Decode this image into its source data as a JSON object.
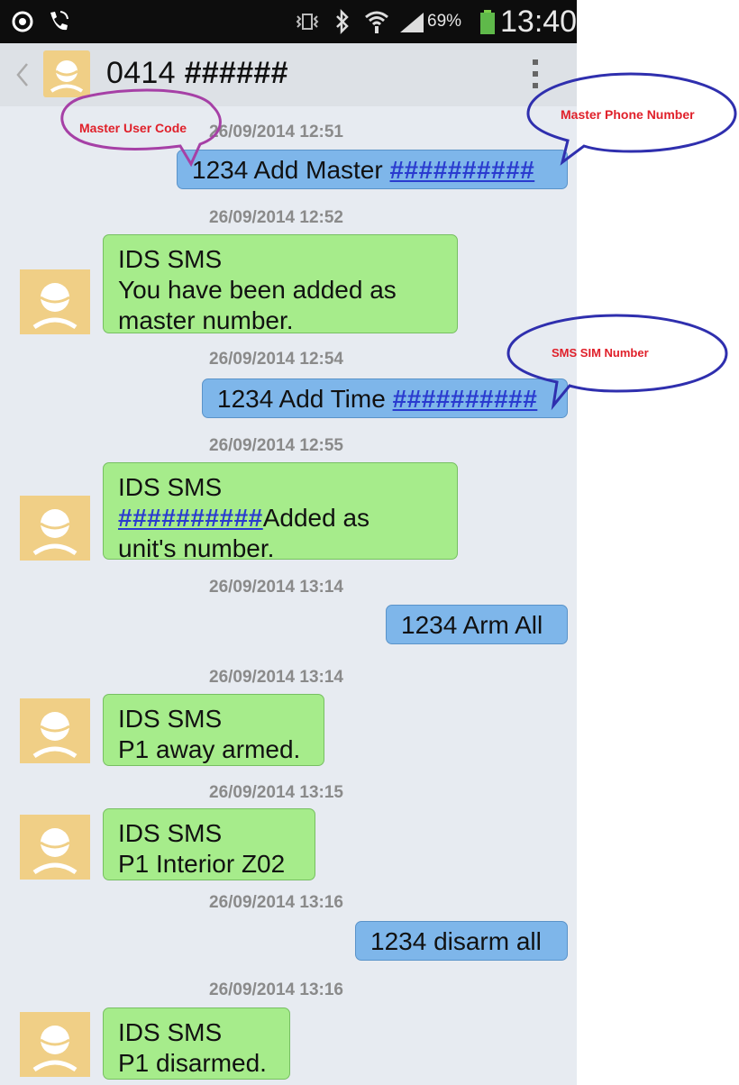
{
  "status_bar": {
    "battery_percent": "69%",
    "time": "13:40",
    "icons": [
      "eye-icon",
      "call-icon",
      "vibrate-icon",
      "bluetooth-icon",
      "wifi-icon",
      "signal-icon",
      "battery-icon"
    ]
  },
  "header": {
    "contact_prefix": "0414",
    "contact_masked": "######",
    "icons": [
      "back-chevron-icon",
      "contact-avatar-icon",
      "overflow-menu-icon"
    ]
  },
  "messages": [
    {
      "timestamp": "26/09/2014 12:51",
      "direction": "sent",
      "text": "1234 Add Master ",
      "masked": "##########"
    },
    {
      "timestamp": "26/09/2014 12:52",
      "direction": "received",
      "lines": [
        "IDS SMS",
        "You have been added as",
        "master number."
      ]
    },
    {
      "timestamp": "26/09/2014 12:54",
      "direction": "sent",
      "text": "1234 Add Time ",
      "masked": "##########"
    },
    {
      "timestamp": "26/09/2014 12:55",
      "direction": "received",
      "lines": [
        "IDS SMS",
        "##########",
        "Added as",
        "unit's number."
      ]
    },
    {
      "timestamp": "26/09/2014 13:14",
      "direction": "sent",
      "text": "1234 Arm All"
    },
    {
      "timestamp": "26/09/2014 13:14",
      "direction": "received",
      "lines": [
        "IDS SMS",
        "P1 away armed."
      ]
    },
    {
      "timestamp": "26/09/2014 13:15",
      "direction": "received",
      "lines": [
        "IDS SMS",
        "P1 Interior  Z02"
      ]
    },
    {
      "timestamp": "26/09/2014 13:16",
      "direction": "sent",
      "text": "1234 disarm all"
    },
    {
      "timestamp": "26/09/2014 13:16",
      "direction": "received",
      "lines": [
        "IDS SMS",
        "P1 disarmed."
      ]
    }
  ],
  "annotations": {
    "master_user_code": "Master User Code",
    "master_phone_number": "Master Phone Number",
    "sms_sim_number": "SMS SIM Number"
  },
  "colors": {
    "sent_bubble": "#7eb6ea",
    "received_bubble": "#a6ec8b",
    "avatar": "#f0cf86",
    "annotation_text": "#e0202a",
    "annotation_purple": "#a640a6",
    "annotation_blue": "#2f2fae",
    "masked_text": "#2a3bcf"
  }
}
